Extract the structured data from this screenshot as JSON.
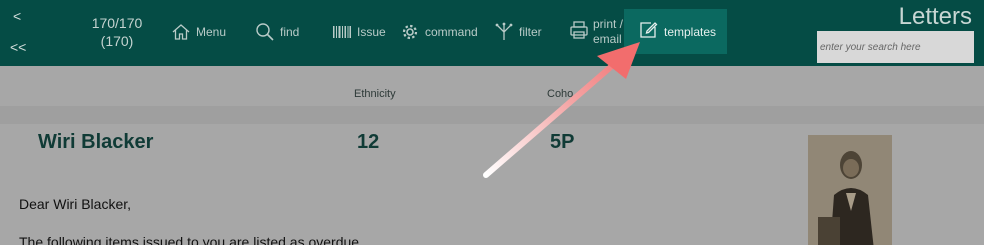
{
  "toolbar": {
    "nav_prev": "<",
    "nav_first": "<<",
    "counter_line1": "170/170",
    "counter_line2": "(170)",
    "menu_label": "Menu",
    "find_label": "find",
    "issue_label": "Issue",
    "command_label": "command",
    "filter_label": "filter",
    "print_label_line1": "print /",
    "print_label_line2": "email",
    "templates_label": "templates",
    "page_title": "Letters",
    "search_placeholder": "enter your search here"
  },
  "columns": {
    "ethnicity": "Ethnicity",
    "cohort": "Coho"
  },
  "record": {
    "name": "Wiri Blacker",
    "ethnicity": "12",
    "cohort": "5P"
  },
  "letter": {
    "greeting": "Dear Wiri Blacker,",
    "body_line": "The following items issued to you are listed as overdue."
  },
  "colors": {
    "toolbar_bg": "#054c45",
    "active_button_bg": "#0b6960",
    "content_bg": "#a7a7a7"
  }
}
